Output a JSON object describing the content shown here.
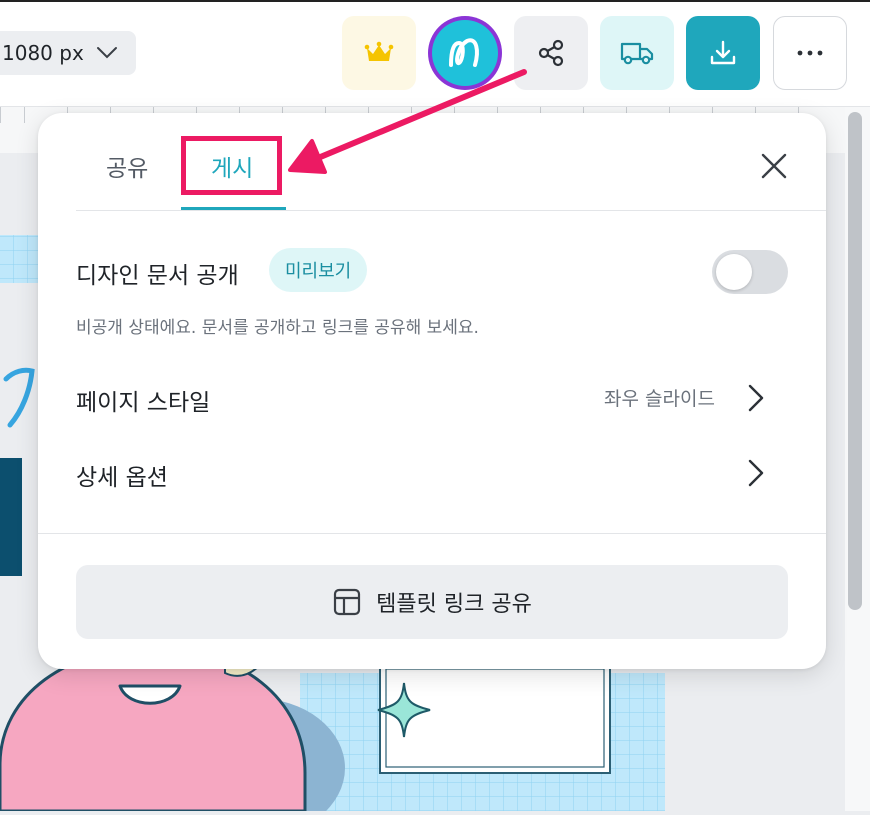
{
  "toolbar": {
    "size_label": "1080 px",
    "icons": [
      "crown-icon",
      "avatar-icon",
      "share-icon",
      "delivery-truck-icon",
      "download-icon",
      "more-icon"
    ],
    "colors": {
      "accent": "#1fa7bc",
      "premium": "#f5c400",
      "avatar_ring": "#8b35d6",
      "avatar_fill": "#1fc1da"
    }
  },
  "panel": {
    "tabs": [
      {
        "label": "공유",
        "active": false
      },
      {
        "label": "게시",
        "active": true
      }
    ],
    "public_title": "디자인 문서 공개",
    "preview_label": "미리보기",
    "toggle_on": false,
    "description": "비공개 상태에요. 문서를 공개하고 링크를 공유해 보세요.",
    "page_style_label": "페이지 스타일",
    "page_style_value": "좌우 슬라이드",
    "detail_options_label": "상세 옵션",
    "template_link_label": "템플릿 링크 공유"
  },
  "annotation": {
    "color": "#ec1a63"
  }
}
